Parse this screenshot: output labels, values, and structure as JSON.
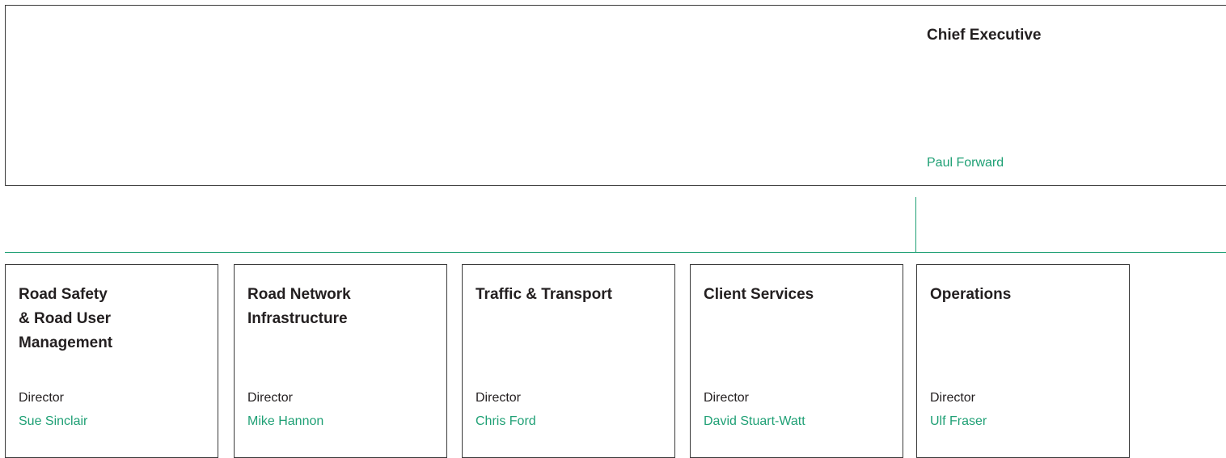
{
  "chief": {
    "title": "Chief Executive",
    "name": "Paul Forward"
  },
  "departments": [
    {
      "title": "Road Safety\n& Road User\nManagement",
      "role": "Director",
      "name": "Sue Sinclair"
    },
    {
      "title": "Road Network\nInfrastructure",
      "role": "Director",
      "name": "Mike Hannon"
    },
    {
      "title": "Traffic & Transport",
      "role": "Director",
      "name": "Chris Ford"
    },
    {
      "title": "Client Services",
      "role": "Director",
      "name": "David Stuart-Watt"
    },
    {
      "title": "Operations",
      "role": "Director",
      "name": "Ulf Fraser"
    }
  ],
  "colors": {
    "accent": "#1fa075",
    "border": "#3a3a3a",
    "text": "#231f20"
  }
}
